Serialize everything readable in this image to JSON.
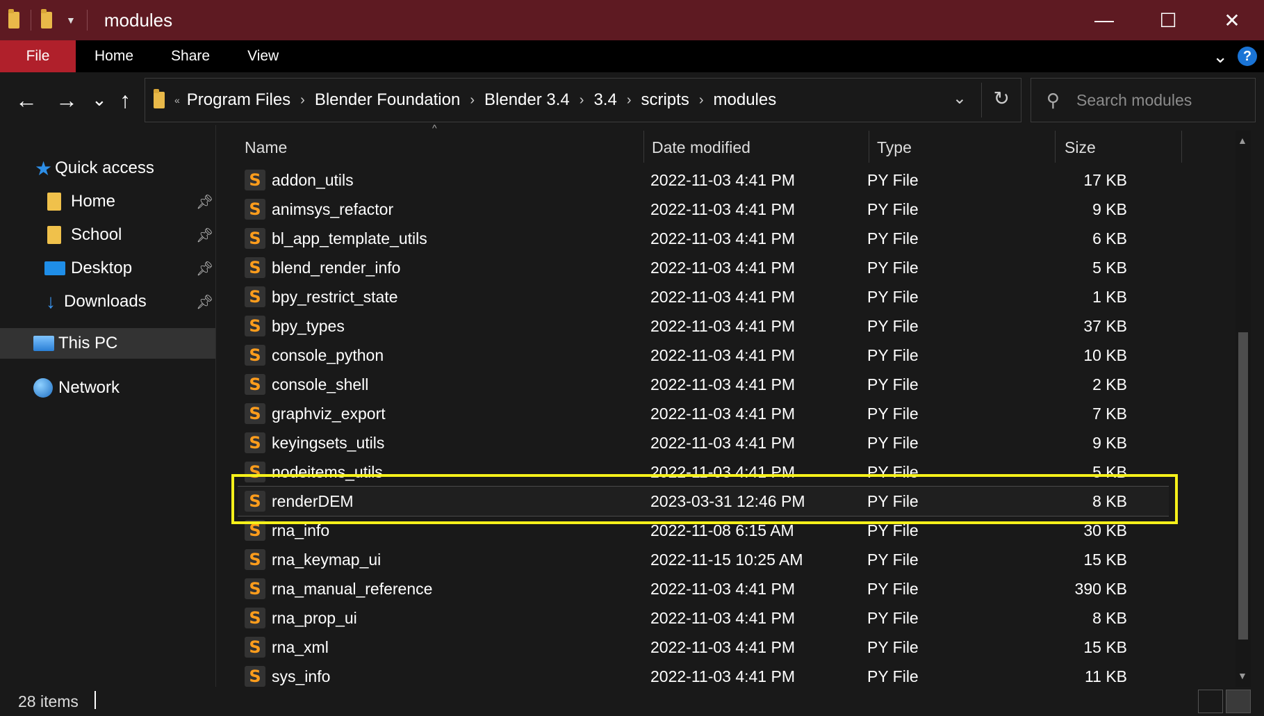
{
  "window": {
    "title": "modules",
    "minimize": "—",
    "maximize": "☐",
    "close": "✕"
  },
  "ribbon": {
    "tabs": [
      "File",
      "Home",
      "Share",
      "View"
    ],
    "help": "?"
  },
  "nav": {
    "back": "←",
    "forward": "→",
    "recent": "⌄",
    "up": "↑"
  },
  "address": {
    "overflow": "«",
    "crumbs": [
      "Program Files",
      "Blender Foundation",
      "Blender 3.4",
      "3.4",
      "scripts",
      "modules"
    ],
    "separator": "›"
  },
  "search": {
    "placeholder": "Search modules"
  },
  "sidebar": {
    "quick_access": "Quick access",
    "items": [
      {
        "label": "Home",
        "pinned": true
      },
      {
        "label": "School",
        "pinned": true
      },
      {
        "label": "Desktop",
        "pinned": true
      },
      {
        "label": "Downloads",
        "pinned": true
      }
    ],
    "this_pc": "This PC",
    "network": "Network"
  },
  "columns": {
    "name": "Name",
    "date": "Date modified",
    "type": "Type",
    "size": "Size"
  },
  "files": [
    {
      "name": "addon_utils",
      "date": "2022-11-03 4:41 PM",
      "type": "PY File",
      "size": "17 KB"
    },
    {
      "name": "animsys_refactor",
      "date": "2022-11-03 4:41 PM",
      "type": "PY File",
      "size": "9 KB"
    },
    {
      "name": "bl_app_template_utils",
      "date": "2022-11-03 4:41 PM",
      "type": "PY File",
      "size": "6 KB"
    },
    {
      "name": "blend_render_info",
      "date": "2022-11-03 4:41 PM",
      "type": "PY File",
      "size": "5 KB"
    },
    {
      "name": "bpy_restrict_state",
      "date": "2022-11-03 4:41 PM",
      "type": "PY File",
      "size": "1 KB"
    },
    {
      "name": "bpy_types",
      "date": "2022-11-03 4:41 PM",
      "type": "PY File",
      "size": "37 KB"
    },
    {
      "name": "console_python",
      "date": "2022-11-03 4:41 PM",
      "type": "PY File",
      "size": "10 KB"
    },
    {
      "name": "console_shell",
      "date": "2022-11-03 4:41 PM",
      "type": "PY File",
      "size": "2 KB"
    },
    {
      "name": "graphviz_export",
      "date": "2022-11-03 4:41 PM",
      "type": "PY File",
      "size": "7 KB"
    },
    {
      "name": "keyingsets_utils",
      "date": "2022-11-03 4:41 PM",
      "type": "PY File",
      "size": "9 KB"
    },
    {
      "name": "nodeitems_utils",
      "date": "2022-11-03 4:41 PM",
      "type": "PY File",
      "size": "5 KB"
    },
    {
      "name": "renderDEM",
      "date": "2023-03-31 12:46 PM",
      "type": "PY File",
      "size": "8 KB",
      "selected": true
    },
    {
      "name": "rna_info",
      "date": "2022-11-08 6:15 AM",
      "type": "PY File",
      "size": "30 KB"
    },
    {
      "name": "rna_keymap_ui",
      "date": "2022-11-15 10:25 AM",
      "type": "PY File",
      "size": "15 KB"
    },
    {
      "name": "rna_manual_reference",
      "date": "2022-11-03 4:41 PM",
      "type": "PY File",
      "size": "390 KB"
    },
    {
      "name": "rna_prop_ui",
      "date": "2022-11-03 4:41 PM",
      "type": "PY File",
      "size": "8 KB"
    },
    {
      "name": "rna_xml",
      "date": "2022-11-03 4:41 PM",
      "type": "PY File",
      "size": "15 KB"
    },
    {
      "name": "sys_info",
      "date": "2022-11-03 4:41 PM",
      "type": "PY File",
      "size": "11 KB"
    }
  ],
  "file_icon_glyph": "S",
  "status": {
    "count": "28 items"
  },
  "colors": {
    "titlebar": "#5e1a22",
    "file_tab": "#b0202b",
    "highlight": "#f5f01a",
    "py_icon": "#ff9d1c"
  }
}
